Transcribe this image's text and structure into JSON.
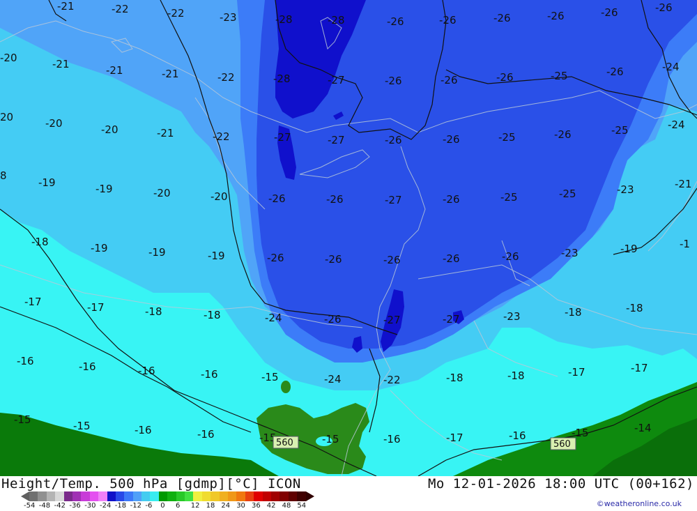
{
  "title_left": "Height/Temp. 500 hPa [gdmp][°C] ICON",
  "title_right": "Mo 12-01-2026 18:00 UTC (00+162)",
  "credit": "©weatheronline.co.uk",
  "scale": {
    "labels": [
      "-54",
      "-48",
      "-42",
      "-36",
      "-30",
      "-24",
      "-18",
      "-12",
      "-6",
      "0",
      "6",
      "12",
      "18",
      "24",
      "30",
      "36",
      "42",
      "48",
      "54"
    ],
    "colors": [
      "#707070",
      "#909090",
      "#b4b4b4",
      "#d8d8d8",
      "#7a2a8a",
      "#a030b4",
      "#c83cd8",
      "#e450f0",
      "#f080f8",
      "#1010c8",
      "#2848e8",
      "#3c78f8",
      "#50a0f8",
      "#44ccf0",
      "#38ecf0",
      "#009900",
      "#10b010",
      "#28c828",
      "#40e040",
      "#f0f040",
      "#f0dc30",
      "#f0c828",
      "#f0b020",
      "#f09818",
      "#f07810",
      "#e84010",
      "#e00000",
      "#c00000",
      "#a00000",
      "#800000",
      "#600000",
      "#400000"
    ]
  },
  "contour_labels": [
    {
      "text": "-21"
    },
    {
      "text": "-22"
    },
    {
      "text": "-22"
    },
    {
      "text": "-23"
    },
    {
      "text": "-28"
    },
    {
      "text": "-28"
    },
    {
      "text": "-26"
    },
    {
      "text": "-26"
    },
    {
      "text": "-26"
    },
    {
      "text": "-26"
    },
    {
      "text": "-26"
    },
    {
      "text": "-26"
    },
    {
      "text": "-20"
    },
    {
      "text": "-21"
    },
    {
      "text": "-21"
    },
    {
      "text": "-21"
    },
    {
      "text": "-22"
    },
    {
      "text": "-28"
    },
    {
      "text": "-27"
    },
    {
      "text": "-26"
    },
    {
      "text": "-26"
    },
    {
      "text": "-26"
    },
    {
      "text": "-25"
    },
    {
      "text": "-26"
    },
    {
      "text": "-24"
    },
    {
      "text": "20"
    },
    {
      "text": "-20"
    },
    {
      "text": "-20"
    },
    {
      "text": "-21"
    },
    {
      "text": "-22"
    },
    {
      "text": "-27"
    },
    {
      "text": "-27"
    },
    {
      "text": "-26"
    },
    {
      "text": "-26"
    },
    {
      "text": "-25"
    },
    {
      "text": "-26"
    },
    {
      "text": "-25"
    },
    {
      "text": "-24"
    },
    {
      "text": "8"
    },
    {
      "text": "-19"
    },
    {
      "text": "-19"
    },
    {
      "text": "-20"
    },
    {
      "text": "-20"
    },
    {
      "text": "-26"
    },
    {
      "text": "-26"
    },
    {
      "text": "-27"
    },
    {
      "text": "-26"
    },
    {
      "text": "-25"
    },
    {
      "text": "-25"
    },
    {
      "text": "-23"
    },
    {
      "text": "-21"
    },
    {
      "text": "-18"
    },
    {
      "text": "-19"
    },
    {
      "text": "-19"
    },
    {
      "text": "-19"
    },
    {
      "text": "-26"
    },
    {
      "text": "-26"
    },
    {
      "text": "-26"
    },
    {
      "text": "-26"
    },
    {
      "text": "-26"
    },
    {
      "text": "-23"
    },
    {
      "text": "-19"
    },
    {
      "text": "-1"
    },
    {
      "text": "-17"
    },
    {
      "text": "-17"
    },
    {
      "text": "-18"
    },
    {
      "text": "-18"
    },
    {
      "text": "-24"
    },
    {
      "text": "-26"
    },
    {
      "text": "-27"
    },
    {
      "text": "-27"
    },
    {
      "text": "-23"
    },
    {
      "text": "-18"
    },
    {
      "text": "-18"
    },
    {
      "text": "-16"
    },
    {
      "text": "-16"
    },
    {
      "text": "-16"
    },
    {
      "text": "-16"
    },
    {
      "text": "-15"
    },
    {
      "text": "-24"
    },
    {
      "text": "-22"
    },
    {
      "text": "-18"
    },
    {
      "text": "-18"
    },
    {
      "text": "-17"
    },
    {
      "text": "-17"
    },
    {
      "text": "-15"
    },
    {
      "text": "-15"
    },
    {
      "text": "-16"
    },
    {
      "text": "-16"
    },
    {
      "text": "-15"
    },
    {
      "text": "-15"
    },
    {
      "text": "-16"
    },
    {
      "text": "-17"
    },
    {
      "text": "-16"
    },
    {
      "text": "-15"
    },
    {
      "text": "-14"
    }
  ],
  "height_labels": [
    {
      "text": "560"
    },
    {
      "text": "560"
    }
  ]
}
